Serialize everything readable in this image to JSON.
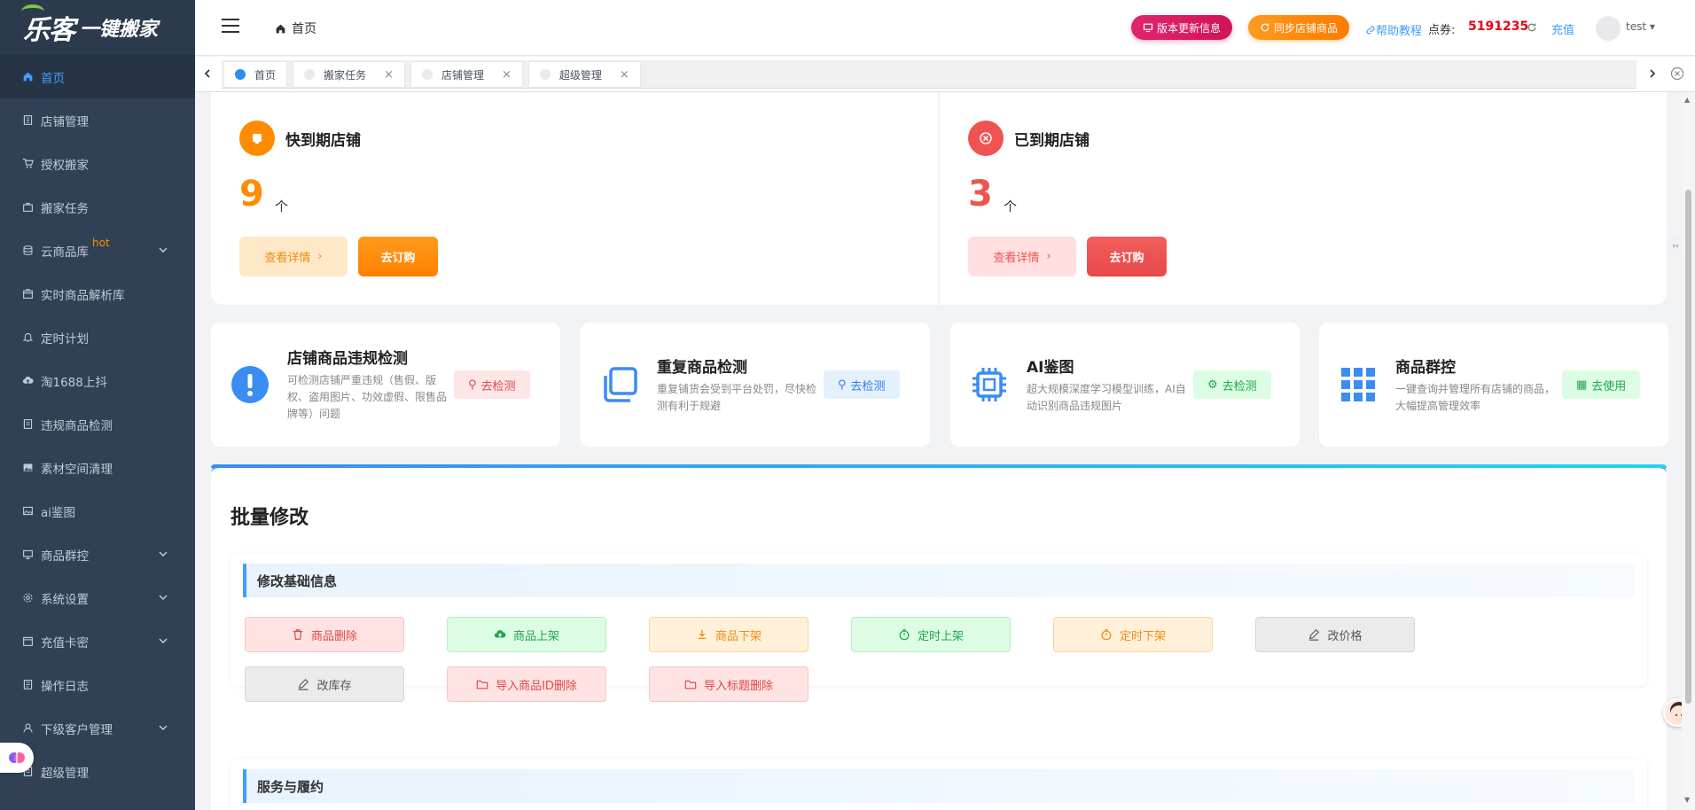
{
  "sidebar": {
    "logo_mark": "乐客",
    "logo_slogan": "一键搬家",
    "items": [
      {
        "label": "首页"
      },
      {
        "label": "店铺管理"
      },
      {
        "label": "授权搬家"
      },
      {
        "label": "搬家任务"
      },
      {
        "label": "云商品库",
        "badge": "hot"
      },
      {
        "label": "实时商品解析库"
      },
      {
        "label": "定时计划"
      },
      {
        "label": "淘1688上抖"
      },
      {
        "label": "违规商品检测"
      },
      {
        "label": "素材空间清理"
      },
      {
        "label": "ai鉴图"
      },
      {
        "label": "商品群控"
      },
      {
        "label": "系统设置"
      },
      {
        "label": "充值卡密"
      },
      {
        "label": "操作日志"
      },
      {
        "label": "下级客户管理"
      },
      {
        "label": "超级管理"
      }
    ]
  },
  "header": {
    "breadcrumb": "首页",
    "version_btn": "版本更新信息",
    "sync_btn": "同步店铺商品",
    "help": "帮助教程",
    "points_label": "点券:",
    "points_value": "5191235",
    "recharge": "充值",
    "user": "test"
  },
  "tabs": [
    {
      "label": "首页",
      "active": true
    },
    {
      "label": "搬家任务"
    },
    {
      "label": "店铺管理"
    },
    {
      "label": "超级管理"
    }
  ],
  "expiry": {
    "soon": {
      "title": "快到期店铺",
      "count": "9",
      "unit": "个",
      "detail": "查看详情",
      "order": "去订购"
    },
    "expired": {
      "title": "已到期店铺",
      "count": "3",
      "unit": "个",
      "detail": "查看详情",
      "order": "去订购"
    }
  },
  "features": [
    {
      "title": "店铺商品违规检测",
      "desc": "可检测店铺严重违规（售假、版权、盗用图片、功效虚假、限售品牌等）问题",
      "btn": "去检测"
    },
    {
      "title": "重复商品检测",
      "desc": "重复铺货会受到平台处罚，尽快检测有利于规避",
      "btn": "去检测"
    },
    {
      "title": "AI鉴图",
      "desc": "超大规模深度学习模型训练，AI自动识别商品违规图片",
      "btn": "去检测"
    },
    {
      "title": "商品群控",
      "desc": "一键查询并管理所有店铺的商品，大幅提高管理效率",
      "btn": "去使用"
    }
  ],
  "batch": {
    "title": "批量修改",
    "basic_section": "修改基础信息",
    "actions": [
      "商品删除",
      "商品上架",
      "商品下架",
      "定时上架",
      "定时下架",
      "改价格",
      "改库存",
      "导入商品ID删除",
      "导入标题删除"
    ],
    "service_section": "服务与履约"
  },
  "colors": {
    "sidebar_bg": "#304156",
    "accent": "#409eff",
    "orange": "#ff8c00",
    "red": "#ef5350"
  }
}
